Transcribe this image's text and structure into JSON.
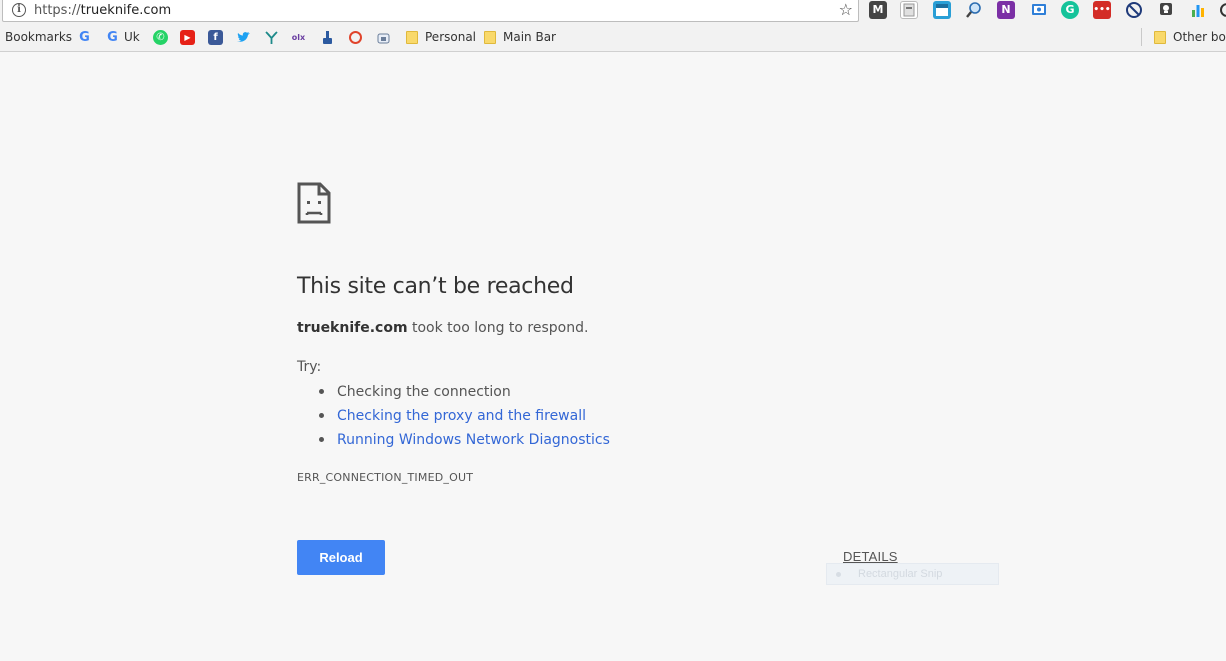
{
  "browser": {
    "url": {
      "scheme": "https://",
      "host": "trueknife.com"
    }
  },
  "extensions": [
    {
      "icon": "gmail-m-icon",
      "glyph": "M",
      "color": "#444444"
    },
    {
      "icon": "document-icon",
      "glyph": "",
      "color": "#cfcfcf"
    },
    {
      "icon": "window-icon",
      "glyph": "",
      "color": "#2a9fd6"
    },
    {
      "icon": "magnifier-icon",
      "glyph": "",
      "color": "#2b6cb0"
    },
    {
      "icon": "onenote-icon",
      "glyph": "N",
      "color": "#7b2fa5"
    },
    {
      "icon": "screen-icon",
      "glyph": "",
      "color": "#2f7fd8"
    },
    {
      "icon": "grammarly-icon",
      "glyph": "G",
      "color": "#15c39a"
    },
    {
      "icon": "lastpass-icon",
      "glyph": "•••",
      "color": "#d32d27"
    },
    {
      "icon": "block-icon",
      "glyph": "",
      "color": "#1f3a7a"
    },
    {
      "icon": "lightbulb-icon",
      "glyph": "",
      "color": "#444444"
    },
    {
      "icon": "chart-icon",
      "glyph": "",
      "color": "#4caf50"
    }
  ],
  "bookmarks": {
    "label": "Bookmarks",
    "items": [
      {
        "icon": "google-icon",
        "label": ""
      },
      {
        "icon": "google-icon",
        "label": "Uk"
      },
      {
        "icon": "whatsapp-icon",
        "label": ""
      },
      {
        "icon": "youtube-icon",
        "label": ""
      },
      {
        "icon": "facebook-icon",
        "label": ""
      },
      {
        "icon": "twitter-icon",
        "label": ""
      },
      {
        "icon": "tree-icon",
        "label": ""
      },
      {
        "icon": "olx-icon",
        "label": ""
      },
      {
        "icon": "hand-icon",
        "label": ""
      },
      {
        "icon": "opera-icon",
        "label": ""
      },
      {
        "icon": "store-icon",
        "label": ""
      }
    ],
    "folders": [
      "Personal",
      "Main Bar"
    ],
    "other": "Other boo"
  },
  "error_page": {
    "title": "This site can’t be reached",
    "host": "trueknife.com",
    "message": " took too long to respond.",
    "try_label": "Try:",
    "suggestions": [
      "Checking the connection",
      "Checking the proxy and the firewall",
      "Running Windows Network Diagnostics"
    ],
    "error_code": "ERR_CONNECTION_TIMED_OUT",
    "reload_label": "Reload",
    "details_label": "DETAILS"
  },
  "tooltip": {
    "text": "Rectangular Snip"
  }
}
